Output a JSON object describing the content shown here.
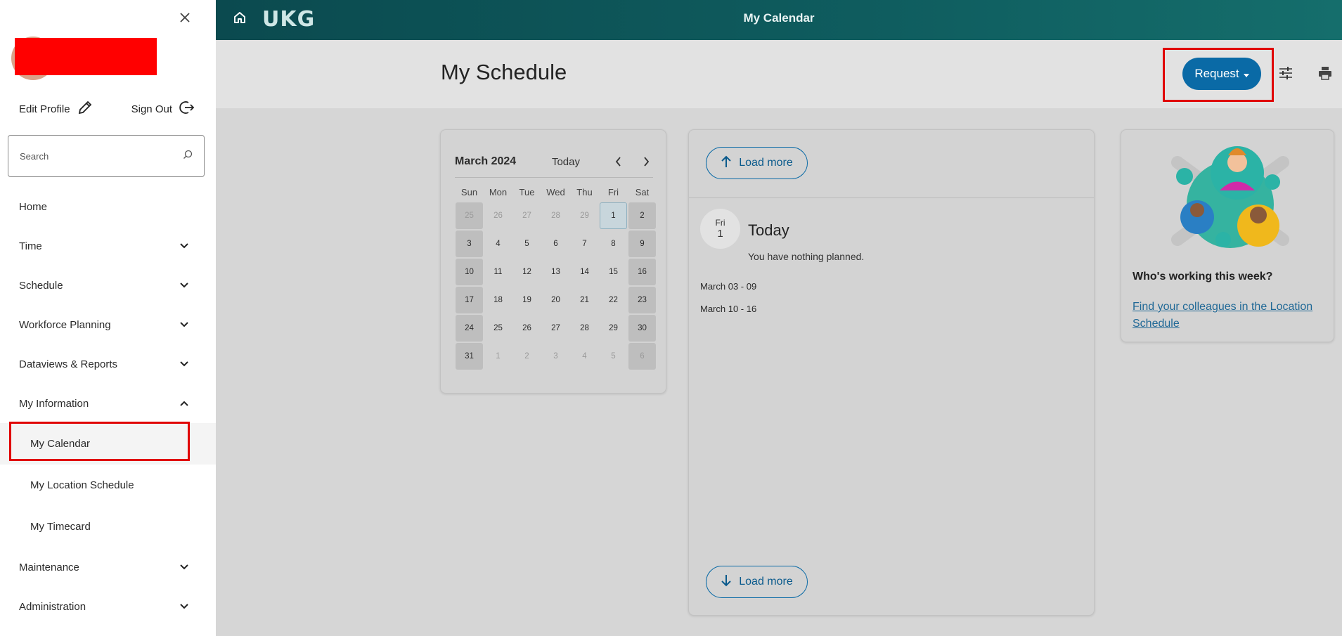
{
  "sidebar": {
    "edit_profile": "Edit Profile",
    "sign_out": "Sign Out",
    "search_placeholder": "Search",
    "nav": {
      "home": "Home",
      "time": "Time",
      "schedule": "Schedule",
      "workforce_planning": "Workforce Planning",
      "dataviews_reports": "Dataviews & Reports",
      "my_information": "My Information",
      "my_calendar": "My Calendar",
      "my_location_schedule": "My Location Schedule",
      "my_timecard": "My Timecard",
      "maintenance": "Maintenance",
      "administration": "Administration"
    }
  },
  "topbar": {
    "logo": "UKG",
    "title": "My Calendar"
  },
  "header": {
    "page_title": "My Schedule",
    "request_label": "Request"
  },
  "mini_calendar": {
    "month": "March 2024",
    "today_label": "Today",
    "weekdays": [
      "Sun",
      "Mon",
      "Tue",
      "Wed",
      "Thu",
      "Fri",
      "Sat"
    ],
    "days": [
      "25",
      "26",
      "27",
      "28",
      "29",
      "1",
      "2",
      "3",
      "4",
      "5",
      "6",
      "7",
      "8",
      "9",
      "10",
      "11",
      "12",
      "13",
      "14",
      "15",
      "16",
      "17",
      "18",
      "19",
      "20",
      "21",
      "22",
      "23",
      "24",
      "25",
      "26",
      "27",
      "28",
      "29",
      "30",
      "31",
      "1",
      "2",
      "3",
      "4",
      "5",
      "6"
    ]
  },
  "schedule": {
    "load_more_top": "Load more",
    "load_more_bottom": "Load more",
    "today_dow": "Fri",
    "today_num": "1",
    "today_label": "Today",
    "nothing_planned": "You have nothing planned.",
    "weeks": [
      "March 03 - 09",
      "March 10 - 16"
    ]
  },
  "colleagues": {
    "title": "Who's working this week?",
    "link": "Find your colleagues in the Location Schedule"
  }
}
